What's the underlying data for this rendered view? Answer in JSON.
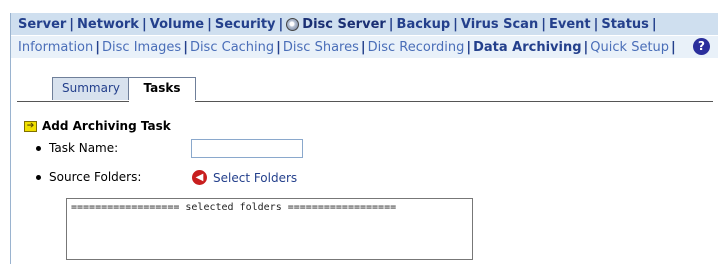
{
  "nav_primary": {
    "items": [
      {
        "label": "Server"
      },
      {
        "label": "Network"
      },
      {
        "label": "Volume"
      },
      {
        "label": "Security"
      },
      {
        "label": "Disc Server",
        "icon": "disc-icon",
        "active": true
      },
      {
        "label": "Backup"
      },
      {
        "label": "Virus Scan"
      },
      {
        "label": "Event"
      },
      {
        "label": "Status"
      }
    ]
  },
  "nav_secondary": {
    "items": [
      {
        "label": "Information"
      },
      {
        "label": "Disc Images"
      },
      {
        "label": "Disc Caching"
      },
      {
        "label": "Disc Shares"
      },
      {
        "label": "Disc Recording"
      },
      {
        "label": "Data Archiving",
        "active": true
      },
      {
        "label": "Quick Setup"
      }
    ],
    "help_label": "?"
  },
  "tabs": [
    {
      "label": "Summary",
      "active": false
    },
    {
      "label": "Tasks",
      "active": true
    }
  ],
  "section": {
    "title": "Add Archiving Task",
    "icon": "arrow-right-icon"
  },
  "form": {
    "task_name_label": "Task Name:",
    "task_name_value": "",
    "source_folders_label": "Source Folders:",
    "select_folders_label": "Select Folders",
    "selected_folders_text": "================== selected folders =================="
  },
  "colors": {
    "nav_primary_bg": "#cfdfef",
    "nav_secondary_bg": "#e9f1f9",
    "link": "#24408c"
  }
}
